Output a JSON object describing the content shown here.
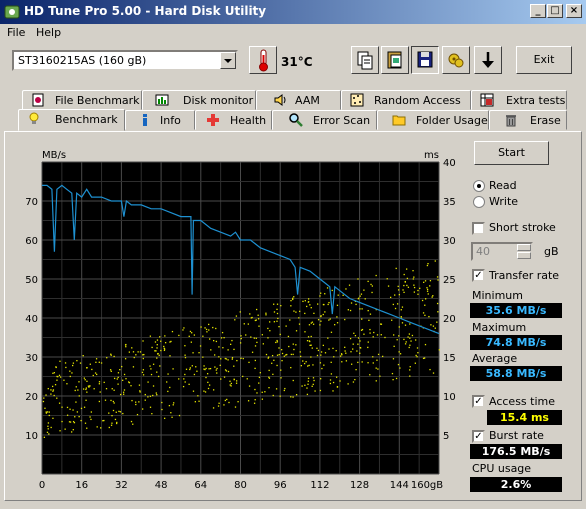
{
  "window": {
    "title": "HD Tune Pro 5.00 - Hard Disk Utility"
  },
  "menu": {
    "file": "File",
    "help": "Help"
  },
  "toolbar": {
    "drive": "ST3160215AS (160 gB)",
    "temperature": "31°C",
    "exit_label": "Exit"
  },
  "tabs_top": [
    {
      "label": "File Benchmark",
      "icon": "file-benchmark-icon"
    },
    {
      "label": "Disk monitor",
      "icon": "disk-monitor-icon"
    },
    {
      "label": "AAM",
      "icon": "speaker-icon"
    },
    {
      "label": "Random Access",
      "icon": "random-access-icon"
    },
    {
      "label": "Extra tests",
      "icon": "extra-tests-icon"
    }
  ],
  "tabs_bottom": [
    {
      "label": "Benchmark",
      "icon": "lightbulb-icon"
    },
    {
      "label": "Info",
      "icon": "info-icon"
    },
    {
      "label": "Health",
      "icon": "health-cross-icon"
    },
    {
      "label": "Error Scan",
      "icon": "magnifier-icon"
    },
    {
      "label": "Folder Usage",
      "icon": "folder-icon"
    },
    {
      "label": "Erase",
      "icon": "trash-icon"
    }
  ],
  "controls": {
    "start_label": "Start",
    "read_label": "Read",
    "write_label": "Write",
    "mode_selected": "Read",
    "short_stroke_label": "Short stroke",
    "short_stroke_checked": false,
    "short_stroke_value": "40",
    "short_stroke_unit": "gB",
    "transfer_rate_label": "Transfer rate",
    "transfer_rate_checked": true,
    "minimum_label": "Minimum",
    "minimum_value": "35.6 MB/s",
    "maximum_label": "Maximum",
    "maximum_value": "74.8 MB/s",
    "average_label": "Average",
    "average_value": "58.8 MB/s",
    "access_time_label": "Access time",
    "access_time_checked": true,
    "access_time_value": "15.4 ms",
    "burst_rate_label": "Burst rate",
    "burst_rate_checked": true,
    "burst_rate_value": "176.5 MB/s",
    "cpu_usage_label": "CPU usage",
    "cpu_usage_value": "2.6%"
  },
  "colors": {
    "chart_bg": "#000000",
    "transfer_line": "#1e90d0",
    "access_dots": "#e6e600",
    "minimum_text": "#39b9ff",
    "access_text": "#ffff00",
    "burst_text": "#ffffff",
    "cpu_text": "#ffffff"
  },
  "chart_data": {
    "type": "line",
    "ylabel_left": "MB/s",
    "ylabel_right": "ms",
    "x_unit": "gB",
    "xlim": [
      0,
      160
    ],
    "ylim_left": [
      0,
      80
    ],
    "ylim_right": [
      0,
      40
    ],
    "x_ticks": [
      "0",
      "16",
      "32",
      "48",
      "64",
      "80",
      "96",
      "112",
      "128",
      "144",
      "160gB"
    ],
    "y_ticks_left": [
      "10",
      "20",
      "30",
      "40",
      "50",
      "60",
      "70"
    ],
    "y_ticks_right": [
      "5",
      "10",
      "15",
      "20",
      "25",
      "30",
      "35",
      "40"
    ],
    "grid": true,
    "series": [
      {
        "name": "Transfer rate",
        "axis": "left",
        "x": [
          0,
          2,
          4,
          5,
          6,
          8,
          10,
          12,
          13,
          14,
          16,
          18,
          20,
          24,
          28,
          32,
          33,
          34,
          36,
          40,
          44,
          48,
          52,
          56,
          60,
          60.5,
          61,
          64,
          68,
          72,
          76,
          78,
          80,
          84,
          88,
          92,
          96,
          100,
          102,
          103,
          104,
          108,
          112,
          114,
          116,
          117,
          118,
          120,
          124,
          128,
          132,
          136,
          140,
          144,
          148,
          152,
          156,
          160
        ],
        "y": [
          74,
          74,
          73,
          57,
          73,
          74,
          73,
          72,
          60,
          72,
          71,
          73,
          71,
          71,
          70,
          70,
          66,
          70,
          69,
          69,
          68,
          68,
          67,
          66,
          66,
          46,
          65,
          65,
          63,
          62,
          61,
          62,
          60,
          60,
          58,
          57,
          56,
          55,
          53,
          46,
          53,
          52,
          50,
          49,
          48,
          41,
          48,
          47,
          45,
          44,
          43,
          42,
          41,
          40,
          39,
          38,
          37,
          36
        ]
      },
      {
        "name": "Access time",
        "axis": "right",
        "trend_start_ms": [
          4.5,
          14
        ],
        "trend_end_ms": [
          13,
          28
        ],
        "count": 750
      }
    ]
  }
}
